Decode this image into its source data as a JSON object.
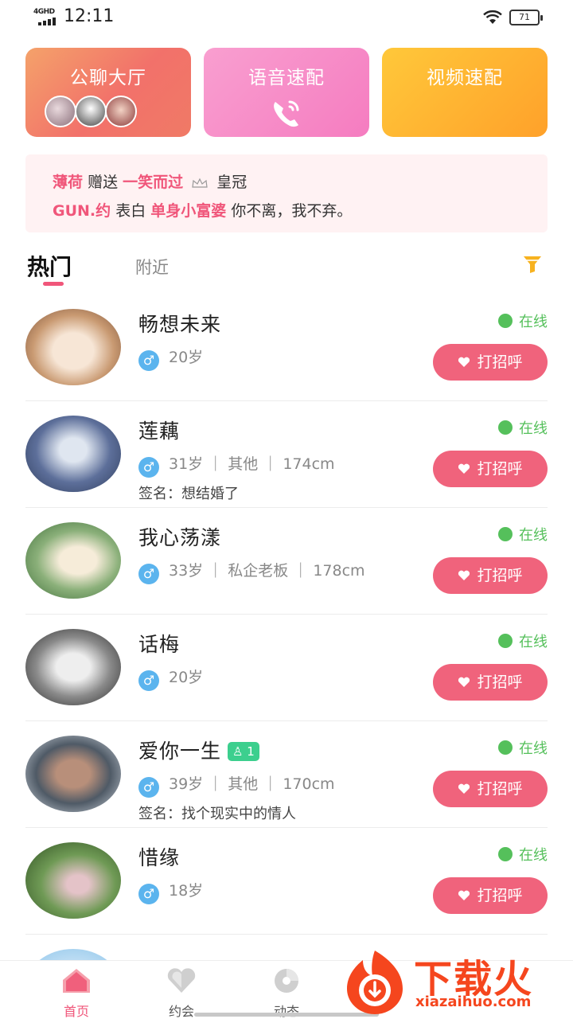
{
  "status_bar": {
    "network": "4GHD",
    "time": "12:11",
    "battery": "71"
  },
  "cards": [
    {
      "title": "公聊大厅"
    },
    {
      "title": "语音速配"
    },
    {
      "title": "视频速配"
    }
  ],
  "gift_banner": {
    "line1": {
      "sender": "薄荷",
      "action": "赠送",
      "target": "一笑而过",
      "item": "皇冠"
    },
    "line2": {
      "sender": "GUN.约",
      "action": "表白",
      "target": "单身小富婆",
      "message": "你不离，我不弃。"
    }
  },
  "tabs": {
    "hot": "热门",
    "nearby": "附近"
  },
  "users": [
    {
      "name": "畅想未来",
      "meta": "20岁",
      "signature": "",
      "status": "在线",
      "button": "打招呼"
    },
    {
      "name": "莲藕",
      "meta": "31岁 ｜ 其他 ｜ 174cm",
      "signature": "签名：想结婚了",
      "status": "在线",
      "button": "打招呼"
    },
    {
      "name": "我心荡漾",
      "meta": "33岁 ｜ 私企老板 ｜ 178cm",
      "signature": "",
      "status": "在线",
      "button": "打招呼"
    },
    {
      "name": "话梅",
      "meta": "20岁",
      "signature": "",
      "status": "在线",
      "button": "打招呼"
    },
    {
      "name": "爱你一生",
      "badge": "1",
      "meta": "39岁 ｜ 其他 ｜ 170cm",
      "signature": "签名：找个现实中的情人",
      "status": "在线",
      "button": "打招呼"
    },
    {
      "name": "惜缘",
      "meta": "18岁",
      "signature": "",
      "status": "在线",
      "button": "打招呼"
    }
  ],
  "bottom_nav": [
    {
      "label": "首页",
      "icon": "home-icon"
    },
    {
      "label": "约会",
      "icon": "heart-icon"
    },
    {
      "label": "动态",
      "icon": "disc-icon"
    }
  ],
  "watermark": {
    "title": "下载火",
    "url": "xiazaihuo.com"
  },
  "colors": {
    "accent": "#f0567a",
    "online": "#55c05b",
    "male": "#5bb4ee"
  }
}
